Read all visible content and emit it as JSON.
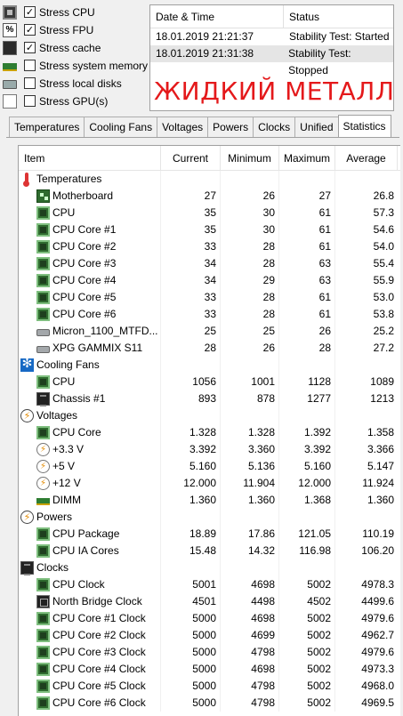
{
  "stress_options": [
    {
      "label": "Stress CPU",
      "checked": true,
      "icon": "cpu-icon"
    },
    {
      "label": "Stress FPU",
      "checked": true,
      "icon": "fpu-icon"
    },
    {
      "label": "Stress cache",
      "checked": true,
      "icon": "cache-icon"
    },
    {
      "label": "Stress system memory",
      "checked": false,
      "icon": "memory-icon"
    },
    {
      "label": "Stress local disks",
      "checked": false,
      "icon": "disk-icon"
    },
    {
      "label": "Stress GPU(s)",
      "checked": false,
      "icon": "gpu-icon"
    }
  ],
  "log": {
    "col_datetime": "Date & Time",
    "col_status": "Status",
    "rows": [
      {
        "datetime": "18.01.2019 21:21:37",
        "status": "Stability Test: Started"
      },
      {
        "datetime": "18.01.2019 21:31:38",
        "status": "Stability Test: Stopped"
      }
    ],
    "banner": "ЖИДКИЙ МЕТАЛЛ",
    "banner_color": "#e4191b"
  },
  "tabs": [
    "Temperatures",
    "Cooling Fans",
    "Voltages",
    "Powers",
    "Clocks",
    "Unified",
    "Statistics"
  ],
  "active_tab": "Statistics",
  "stats": {
    "headers": {
      "item": "Item",
      "current": "Current",
      "minimum": "Minimum",
      "maximum": "Maximum",
      "average": "Average"
    },
    "rows": [
      {
        "type": "group",
        "icon": "thermometer-icon",
        "item": "Temperatures"
      },
      {
        "type": "child",
        "icon": "motherboard-icon",
        "item": "Motherboard",
        "current": "27",
        "minimum": "26",
        "maximum": "27",
        "average": "26.8"
      },
      {
        "type": "child",
        "icon": "chip-icon",
        "item": "CPU",
        "current": "35",
        "minimum": "30",
        "maximum": "61",
        "average": "57.3"
      },
      {
        "type": "child",
        "icon": "chip-icon",
        "item": "CPU Core #1",
        "current": "35",
        "minimum": "30",
        "maximum": "61",
        "average": "54.6"
      },
      {
        "type": "child",
        "icon": "chip-icon",
        "item": "CPU Core #2",
        "current": "33",
        "minimum": "28",
        "maximum": "61",
        "average": "54.0"
      },
      {
        "type": "child",
        "icon": "chip-icon",
        "item": "CPU Core #3",
        "current": "34",
        "minimum": "28",
        "maximum": "63",
        "average": "55.4"
      },
      {
        "type": "child",
        "icon": "chip-icon",
        "item": "CPU Core #4",
        "current": "34",
        "minimum": "29",
        "maximum": "63",
        "average": "55.9"
      },
      {
        "type": "child",
        "icon": "chip-icon",
        "item": "CPU Core #5",
        "current": "33",
        "minimum": "28",
        "maximum": "61",
        "average": "53.0"
      },
      {
        "type": "child",
        "icon": "chip-icon",
        "item": "CPU Core #6",
        "current": "33",
        "minimum": "28",
        "maximum": "61",
        "average": "53.8"
      },
      {
        "type": "child",
        "icon": "disk-icon",
        "item": "Micron_1100_MTFD...",
        "current": "25",
        "minimum": "25",
        "maximum": "26",
        "average": "25.2"
      },
      {
        "type": "child",
        "icon": "disk-icon",
        "item": "XPG GAMMIX S11",
        "current": "28",
        "minimum": "26",
        "maximum": "28",
        "average": "27.2"
      },
      {
        "type": "group",
        "icon": "fan-icon",
        "item": "Cooling Fans"
      },
      {
        "type": "child",
        "icon": "chip-icon",
        "item": "CPU",
        "current": "1056",
        "minimum": "1001",
        "maximum": "1128",
        "average": "1089"
      },
      {
        "type": "child",
        "icon": "chassis-icon",
        "item": "Chassis #1",
        "current": "893",
        "minimum": "878",
        "maximum": "1277",
        "average": "1213"
      },
      {
        "type": "group",
        "icon": "voltage-icon",
        "item": "Voltages"
      },
      {
        "type": "child",
        "icon": "chip-icon",
        "item": "CPU Core",
        "current": "1.328",
        "minimum": "1.328",
        "maximum": "1.392",
        "average": "1.358"
      },
      {
        "type": "child",
        "icon": "bolt-icon",
        "item": "+3.3 V",
        "current": "3.392",
        "minimum": "3.360",
        "maximum": "3.392",
        "average": "3.366"
      },
      {
        "type": "child",
        "icon": "bolt-icon",
        "item": "+5 V",
        "current": "5.160",
        "minimum": "5.136",
        "maximum": "5.160",
        "average": "5.147"
      },
      {
        "type": "child",
        "icon": "bolt-icon",
        "item": "+12 V",
        "current": "12.000",
        "minimum": "11.904",
        "maximum": "12.000",
        "average": "11.924"
      },
      {
        "type": "child",
        "icon": "dimm-icon",
        "item": "DIMM",
        "current": "1.360",
        "minimum": "1.360",
        "maximum": "1.368",
        "average": "1.360"
      },
      {
        "type": "group",
        "icon": "power-icon",
        "item": "Powers"
      },
      {
        "type": "child",
        "icon": "chip-icon",
        "item": "CPU Package",
        "current": "18.89",
        "minimum": "17.86",
        "maximum": "121.05",
        "average": "110.19"
      },
      {
        "type": "child",
        "icon": "chip-icon",
        "item": "CPU IA Cores",
        "current": "15.48",
        "minimum": "14.32",
        "maximum": "116.98",
        "average": "106.20"
      },
      {
        "type": "group",
        "icon": "clock-icon",
        "item": "Clocks"
      },
      {
        "type": "child",
        "icon": "chip-icon",
        "item": "CPU Clock",
        "current": "5001",
        "minimum": "4698",
        "maximum": "5002",
        "average": "4978.3"
      },
      {
        "type": "child",
        "icon": "northbridge-icon",
        "item": "North Bridge Clock",
        "current": "4501",
        "minimum": "4498",
        "maximum": "4502",
        "average": "4499.6"
      },
      {
        "type": "child",
        "icon": "chip-icon",
        "item": "CPU Core #1 Clock",
        "current": "5000",
        "minimum": "4698",
        "maximum": "5002",
        "average": "4979.6"
      },
      {
        "type": "child",
        "icon": "chip-icon",
        "item": "CPU Core #2 Clock",
        "current": "5000",
        "minimum": "4699",
        "maximum": "5002",
        "average": "4962.7"
      },
      {
        "type": "child",
        "icon": "chip-icon",
        "item": "CPU Core #3 Clock",
        "current": "5000",
        "minimum": "4798",
        "maximum": "5002",
        "average": "4979.6"
      },
      {
        "type": "child",
        "icon": "chip-icon",
        "item": "CPU Core #4 Clock",
        "current": "5000",
        "minimum": "4698",
        "maximum": "5002",
        "average": "4973.3"
      },
      {
        "type": "child",
        "icon": "chip-icon",
        "item": "CPU Core #5 Clock",
        "current": "5000",
        "minimum": "4798",
        "maximum": "5002",
        "average": "4968.0"
      },
      {
        "type": "child",
        "icon": "chip-icon",
        "item": "CPU Core #6 Clock",
        "current": "5000",
        "minimum": "4798",
        "maximum": "5002",
        "average": "4969.5"
      }
    ]
  }
}
